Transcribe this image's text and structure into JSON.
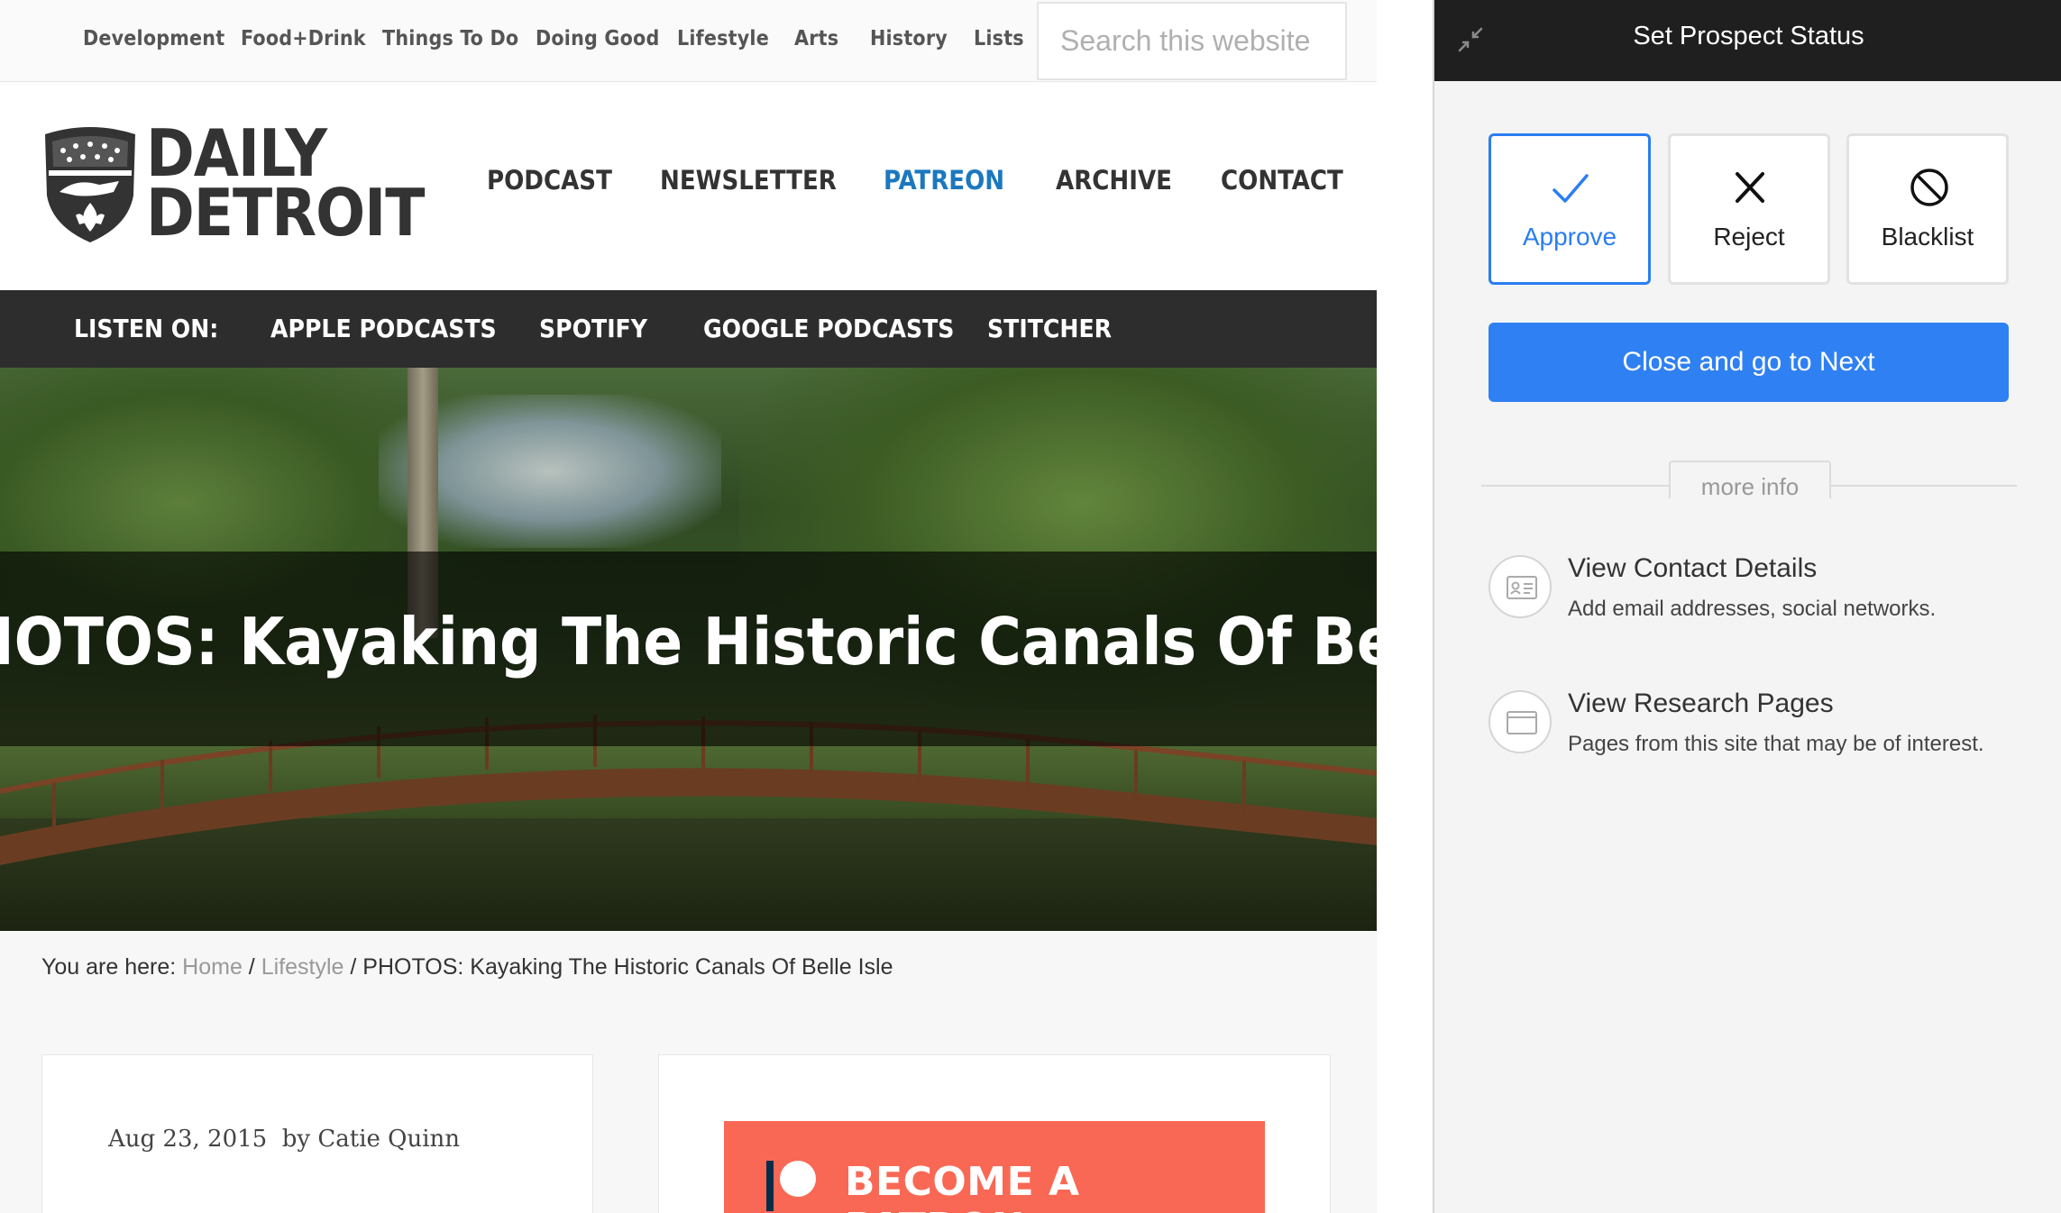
{
  "site": {
    "top_nav": [
      "Development",
      "Food+Drink",
      "Things To Do",
      "Doing Good",
      "Lifestyle",
      "Arts",
      "History",
      "Lists"
    ],
    "search_placeholder": "Search this website",
    "logo_line1": "DAILY",
    "logo_line2": "DETROIT",
    "main_nav": [
      {
        "label": "PODCAST",
        "active": false
      },
      {
        "label": "NEWSLETTER",
        "active": false
      },
      {
        "label": "PATREON",
        "active": true
      },
      {
        "label": "ARCHIVE",
        "active": false
      },
      {
        "label": "CONTACT",
        "active": false
      }
    ],
    "listen_on": {
      "label": "LISTEN ON:",
      "items": [
        "APPLE PODCASTS",
        "SPOTIFY",
        "GOOGLE PODCASTS",
        "STITCHER"
      ]
    },
    "hero_title": "PHOTOS: Kayaking The Historic Canals Of Belle Isle",
    "breadcrumb": {
      "prefix": "You are here:",
      "home": "Home",
      "section": "Lifestyle",
      "current": "PHOTOS: Kayaking The Historic Canals Of Belle Isle",
      "separator": "/"
    },
    "post": {
      "date": "Aug 23, 2015",
      "by": "by",
      "author": "Catie Quinn"
    },
    "patron_button": "BECOME A PATRON",
    "colors": {
      "accent": "#1b78bf",
      "patron": "#f96854",
      "dark_bar": "#2d2d2d"
    }
  },
  "panel": {
    "title": "Set Prospect Status",
    "status_buttons": [
      {
        "label": "Approve",
        "icon": "check-icon",
        "selected": true
      },
      {
        "label": "Reject",
        "icon": "x-icon",
        "selected": false
      },
      {
        "label": "Blacklist",
        "icon": "ban-icon",
        "selected": false
      }
    ],
    "next_button": "Close and go to Next",
    "more_info": "more info",
    "rows": [
      {
        "title": "View Contact Details",
        "description": "Add email addresses, social networks.",
        "icon": "contact-card-icon"
      },
      {
        "title": "View Research Pages",
        "description": "Pages from this site that may be of interest.",
        "icon": "browser-window-icon"
      }
    ],
    "colors": {
      "primary": "#2f80f2",
      "header": "#1f1f1f"
    }
  }
}
